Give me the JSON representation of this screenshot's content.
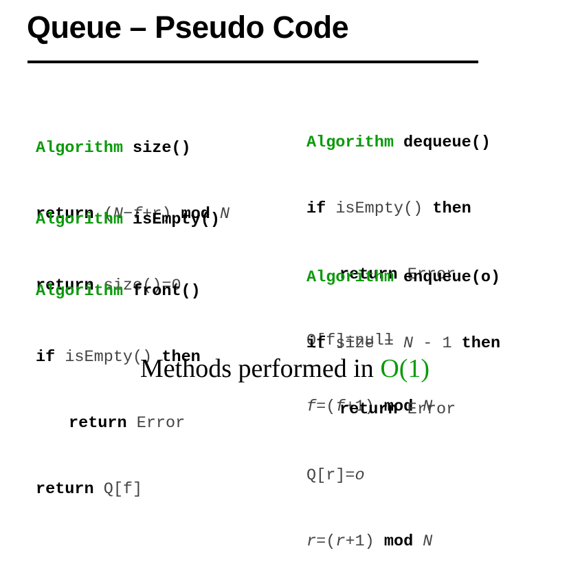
{
  "slide": {
    "title": "Queue – Pseudo Code",
    "footer_text": "Methods performed in ",
    "footer_highlight": "O(1)"
  },
  "left": {
    "size": {
      "kw": "Algorithm",
      "name": " size()",
      "l1_kw": "return",
      "l1_a": " (",
      "l1_b": "N",
      "l1_c": "−",
      "l1_d": "f",
      "l1_e": "+r) ",
      "l1_mod": "mod",
      "l1_sp": " ",
      "l1_n": "N"
    },
    "isempty": {
      "kw": "Algorithm",
      "name": " isEmpty()",
      "l1_kw": "return",
      "l1_rest": " size()=0"
    },
    "front": {
      "kw": "Algorithm",
      "name": " front()",
      "l1_if": "if",
      "l1_mid": " isEmpty() ",
      "l1_then": "then",
      "l2_kw": "return",
      "l2_rest": " Error",
      "l3_kw": "return",
      "l3_rest": " Q[f]"
    }
  },
  "right": {
    "dequeue": {
      "kw": "Algorithm",
      "name": " dequeue()",
      "l1_if": "if",
      "l1_mid": " isEmpty() ",
      "l1_then": "then",
      "l2_kw": "return",
      "l2_rest": " Error",
      "l3": "Q[f]=null",
      "l4_a": "f",
      "l4_b": "=(",
      "l4_c": "f",
      "l4_d": "+1) ",
      "l4_mod": "mod",
      "l4_sp": " ",
      "l4_n": "N"
    },
    "enqueue": {
      "kw": "Algorithm",
      "name": " enqueue(o)",
      "l1_if": "if",
      "l1_mid": " size = ",
      "l1_n": "N",
      "l1_minus": " - 1 ",
      "l1_then": "then",
      "l2_kw": "return",
      "l2_rest": " Error",
      "l3_a": "Q[r]=",
      "l3_b": "o",
      "l4_a": "r",
      "l4_b": "=(",
      "l4_c": "r",
      "l4_d": "+1) ",
      "l4_mod": "mod",
      "l4_sp": " ",
      "l4_n": "N"
    }
  }
}
